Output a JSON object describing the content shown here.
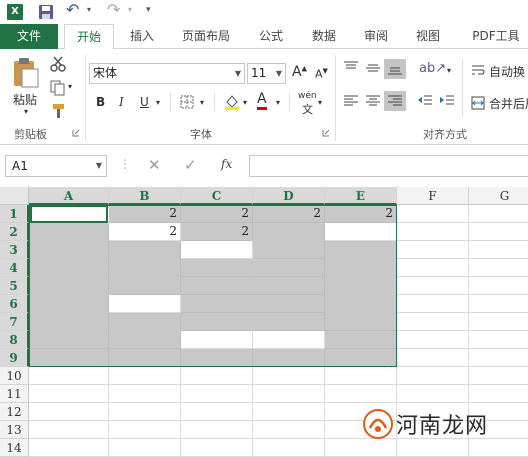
{
  "qat": {
    "undo": "↶",
    "redo": "↷",
    "customize": "▾"
  },
  "tabs": [
    "文件",
    "开始",
    "插入",
    "页面布局",
    "公式",
    "数据",
    "审阅",
    "视图",
    "PDF工具"
  ],
  "ribbon": {
    "clipboard": {
      "paste": "粘贴",
      "label": "剪贴板"
    },
    "font": {
      "name": "宋体",
      "size": "11",
      "bold": "B",
      "italic": "I",
      "underline": "U",
      "phonetic": "wén",
      "label": "字体"
    },
    "alignment": {
      "wrap": "自动换",
      "merge": "合并后居",
      "label": "对齐方式"
    }
  },
  "formula_bar": {
    "name_box": "A1",
    "fx": "fx",
    "value": ""
  },
  "columns": [
    "A",
    "B",
    "C",
    "D",
    "E",
    "F",
    "G"
  ],
  "rows": [
    "1",
    "2",
    "3",
    "4",
    "5",
    "6",
    "7",
    "8",
    "9",
    "10",
    "11",
    "12",
    "13",
    "14"
  ],
  "cells": {
    "B1": "2",
    "C1": "2",
    "D1": "2",
    "E1": "2",
    "B2": "2",
    "C2": "2"
  },
  "watermark": {
    "text": "河南龙网"
  },
  "colors": {
    "accent": "#217346",
    "merged_fill": "#c8c8c8"
  }
}
